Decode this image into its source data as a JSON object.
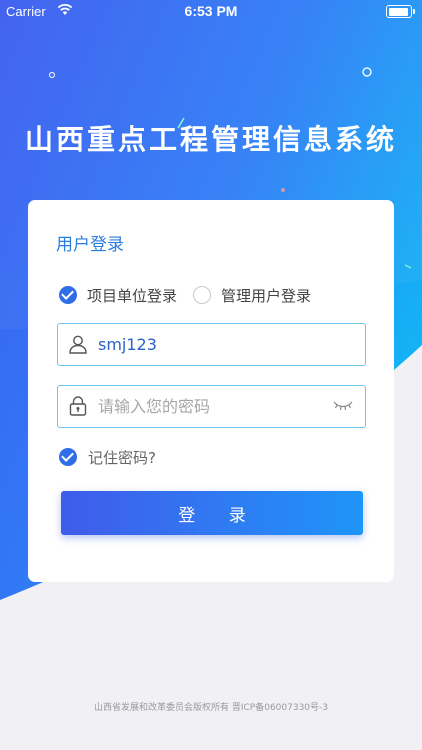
{
  "status_bar": {
    "carrier": "Carrier",
    "time": "6:53 PM"
  },
  "app_title": "山西重点工程管理信息系统",
  "login_card": {
    "title": "用户登录",
    "login_types": [
      {
        "label": "项目单位登录",
        "selected": true
      },
      {
        "label": "管理用户登录",
        "selected": false
      }
    ],
    "username": {
      "value": "smj123",
      "icon": "user-icon"
    },
    "password": {
      "placeholder": "请输入您的密码",
      "icon": "lock-icon",
      "toggle_icon": "eye-closed-icon"
    },
    "remember_password": {
      "label": "记住密码?",
      "checked": true
    },
    "submit_label": "登 录"
  },
  "footer": "山西省发展和改革委员会版权所有 晋ICP备06007330号-3",
  "colors": {
    "accent": "#2f6ee6",
    "title_blue": "#2a7de0",
    "field_border": "#6bc5ec",
    "background": "#f1f1f5"
  }
}
